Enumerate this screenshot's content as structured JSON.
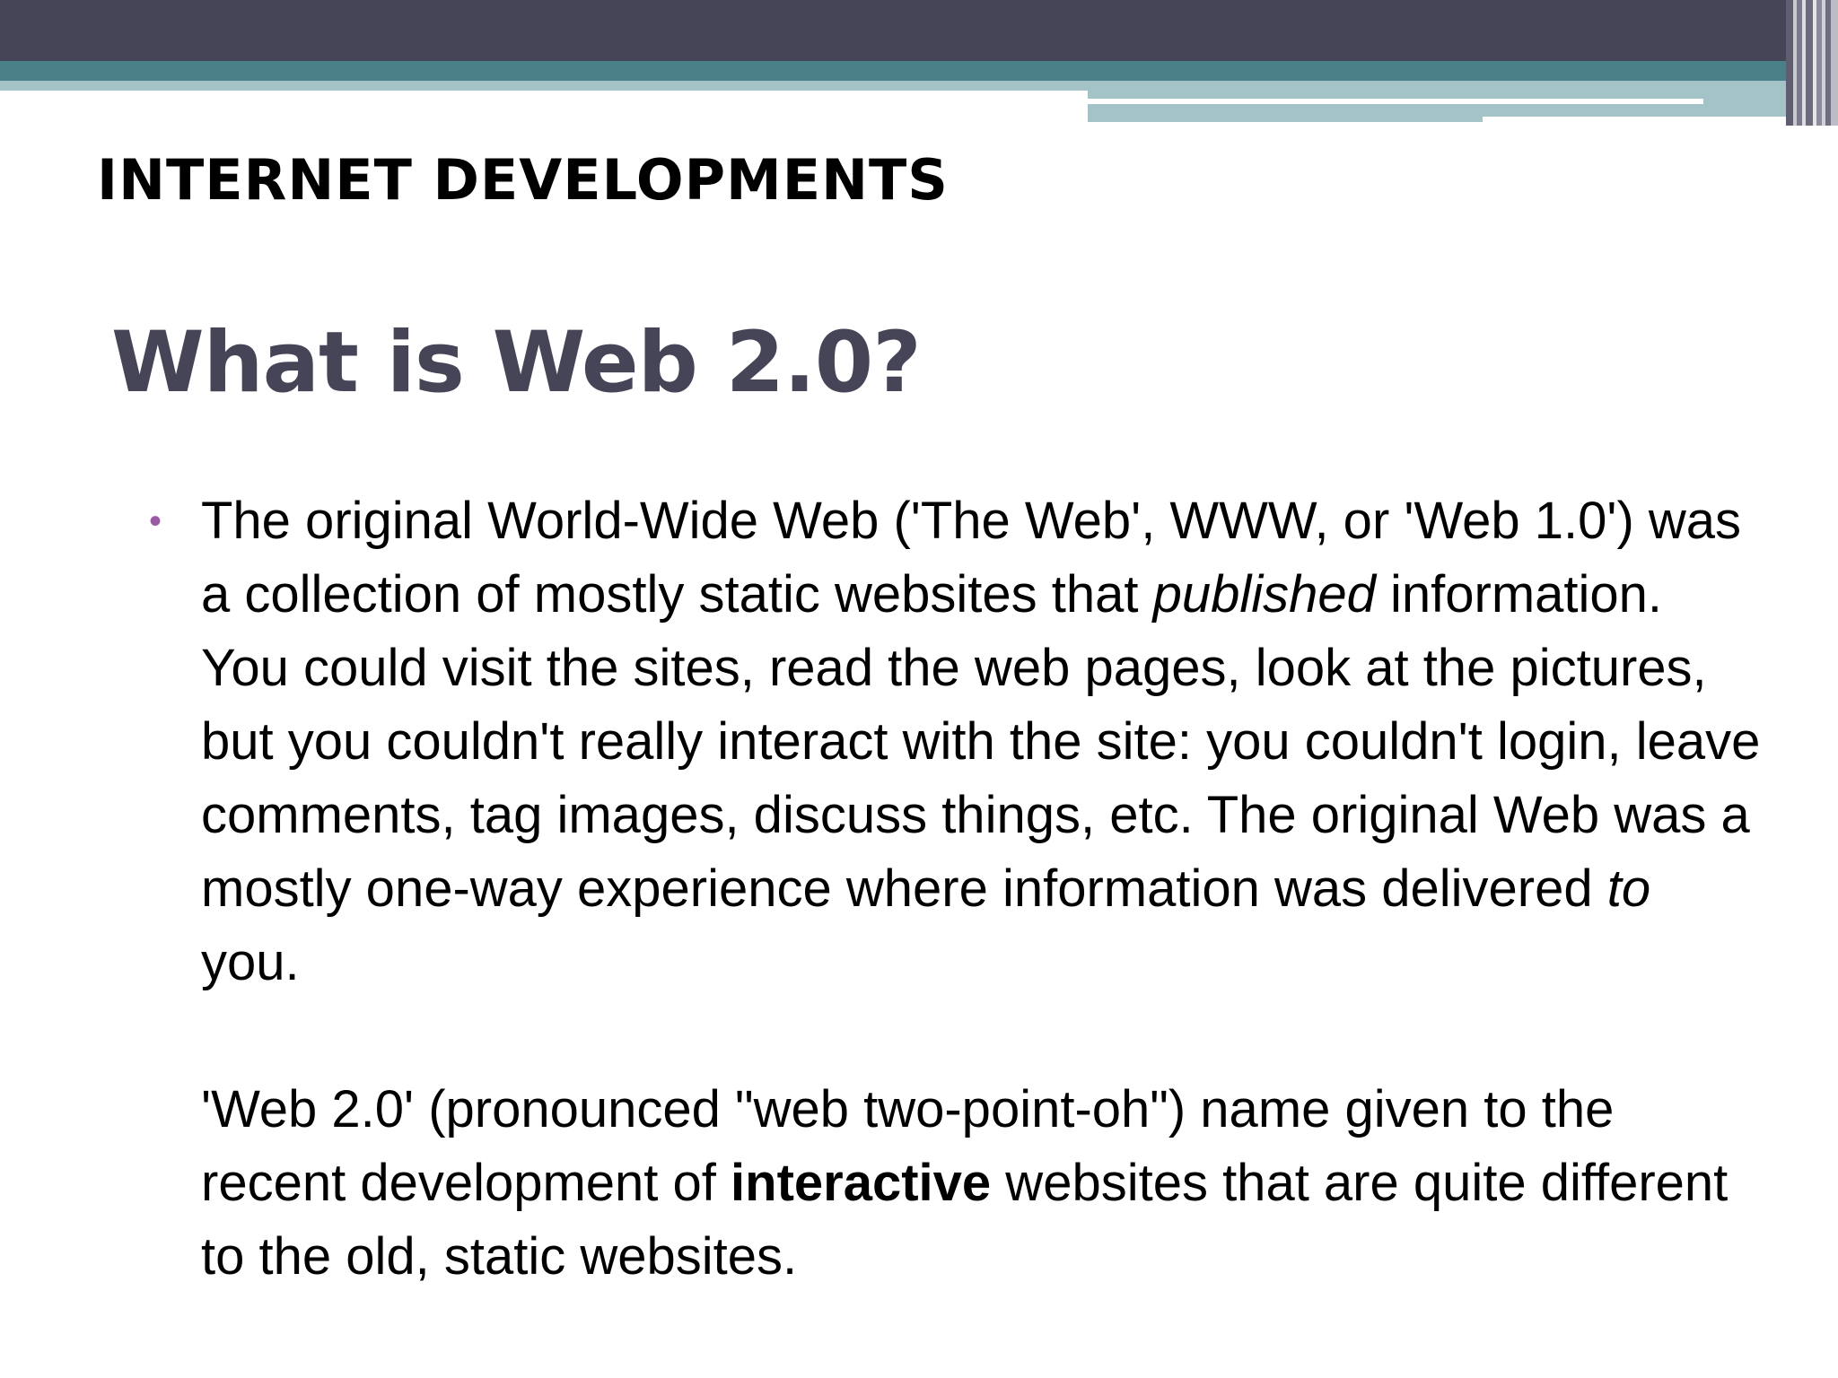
{
  "slide": {
    "header": "INTERNET DEVELOPMENTS",
    "title": "What is Web 2.0?",
    "bullet_symbol": "•",
    "paragraph1": {
      "part1": "The original World-Wide Web ('The Web', WWW, or 'Web 1.0') was a collection of mostly static websites that ",
      "emphasis1": "published",
      "part2": " information. You could visit the sites, read the web pages, look at the pictures, but you couldn't really interact with the site: you couldn't login, leave comments, tag images, discuss things, etc. The original Web was a mostly one-way experience where information was delivered ",
      "emphasis2": "to",
      "part3": " you."
    },
    "paragraph2": {
      "part1": "'Web 2.0' (pronounced \"web two-point-oh\") name given to the recent development of ",
      "strong": "interactive",
      "part2": " websites that are quite different to the old, static websites."
    }
  },
  "colors": {
    "band_dark": "#464558",
    "band_teal": "#4a8088",
    "band_light": "#a4c3c6",
    "title": "#464558",
    "bullet": "#9b5ba4",
    "text": "#000000"
  }
}
